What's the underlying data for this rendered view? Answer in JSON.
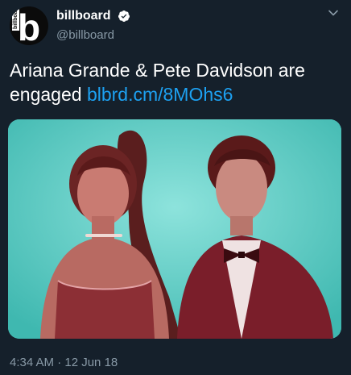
{
  "account": {
    "display_name": "billboard",
    "handle": "@billboard",
    "avatar_text": "b",
    "avatar_wordmark": "billboard",
    "verified_icon": "verified-badge-icon"
  },
  "tweet": {
    "text_prefix": "Ariana Grande & Pete Davidson are engaged ",
    "link_text": "blbrd.cm/8MOhs6",
    "timestamp": "4:34 AM · 12 Jun 18"
  },
  "media": {
    "description_icon": "photo",
    "background_color": "#5cc9c1"
  },
  "colors": {
    "background": "#15202b",
    "link": "#1da1f2",
    "secondary_text": "#8899a6"
  }
}
